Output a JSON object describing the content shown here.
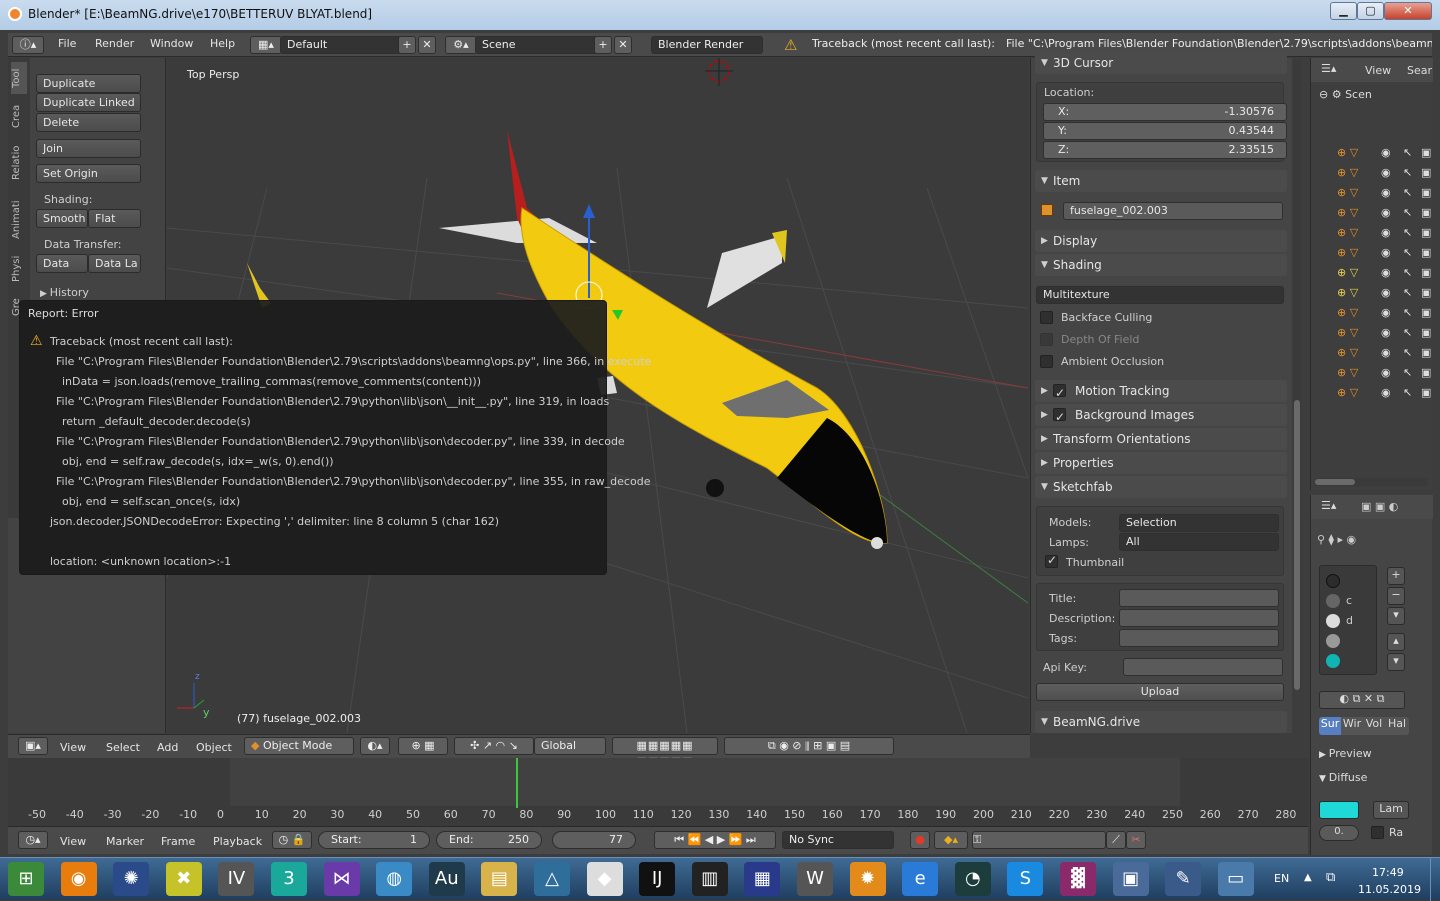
{
  "window": {
    "title": "Blender* [E:\\BeamNG.drive\\e170\\BETTERUV BLYAT.blend]",
    "minimize": "▁",
    "maximize": "▢",
    "close": "✕"
  },
  "infobar": {
    "menus": [
      "File",
      "Render",
      "Window",
      "Help"
    ],
    "screen_layout": "Default",
    "scene": "Scene",
    "render_engine": "Blender Render",
    "report": "Traceback (most recent call last): File \"C:\\Program Files\\Blender Foundation\\Blender\\2.79\\scripts\\addons\\beamng\\ops.py\","
  },
  "toolshelf": {
    "tabs": [
      "Tool",
      "Crea",
      "Relatio",
      "Animati",
      "Physi",
      "Gre"
    ],
    "buttons": [
      "Duplicate",
      "Duplicate Linked",
      "Delete",
      "Join",
      "Set Origin"
    ],
    "shading_label": "Shading:",
    "smooth": "Smooth",
    "flat": "Flat",
    "data_transfer_label": "Data Transfer:",
    "data": "Data",
    "data_la": "Data La",
    "history": "History"
  },
  "viewport": {
    "view_name": "Top Persp",
    "object_label": "(77) fuselage_002.003",
    "axis_z": "z",
    "axis_y": "y"
  },
  "error_report": {
    "header": "Report: Error",
    "lines": [
      "Traceback (most recent call last):",
      "File \"C:\\Program Files\\Blender Foundation\\Blender\\2.79\\scripts\\addons\\beamng\\ops.py\", line 366, in execute",
      "inData = json.loads(remove_trailing_commas(remove_comments(content)))",
      "File \"C:\\Program Files\\Blender Foundation\\Blender\\2.79\\python\\lib\\json\\__init__.py\", line 319, in loads",
      "return _default_decoder.decode(s)",
      "File \"C:\\Program Files\\Blender Foundation\\Blender\\2.79\\python\\lib\\json\\decoder.py\", line 339, in decode",
      "obj, end = self.raw_decode(s, idx=_w(s, 0).end())",
      "File \"C:\\Program Files\\Blender Foundation\\Blender\\2.79\\python\\lib\\json\\decoder.py\", line 355, in raw_decode",
      "obj, end = self.scan_once(s, idx)",
      "json.decoder.JSONDecodeError: Expecting ',' delimiter: line 8 column 5 (char 162)",
      "location: <unknown location>:-1"
    ]
  },
  "properties": {
    "cursor_header": "3D Cursor",
    "location_label": "Location:",
    "x_label": "X:",
    "x": "-1.30576",
    "y_label": "Y:",
    "y": "0.43544",
    "z_label": "Z:",
    "z": "2.33515",
    "item_header": "Item",
    "item_name": "fuselage_002.003",
    "display_header": "Display",
    "shading_header": "Shading",
    "shading_mode": "Multitexture",
    "backface": "Backface Culling",
    "dof": "Depth Of Field",
    "ao": "Ambient Occlusion",
    "motion_tracking": "Motion Tracking",
    "background_images": "Background Images",
    "transform_orientations": "Transform Orientations",
    "properties_header": "Properties",
    "sketchfab_header": "Sketchfab",
    "models_label": "Models:",
    "models_value": "Selection",
    "lamps_label": "Lamps:",
    "lamps_value": "All",
    "thumbnail": "Thumbnail",
    "title_label": "Title:",
    "description_label": "Description:",
    "tags_label": "Tags:",
    "api_key_label": "Api Key:",
    "upload": "Upload",
    "beamng_header": "BeamNG.drive"
  },
  "outliner": {
    "view": "View",
    "search": "Sear",
    "scene_item": "Scen"
  },
  "material": {
    "c": "c",
    "d": "d",
    "sur": "Sur",
    "wir": "Wir",
    "vol": "Vol",
    "hal": "Hal",
    "preview": "Preview",
    "diffuse": "Diffuse",
    "lam": "Lam",
    "val": "0.",
    "ra": "Ra",
    "diffuse_color": "#1fd9d9"
  },
  "view3d_toolbar": {
    "view": "View",
    "select": "Select",
    "add": "Add",
    "object": "Object",
    "mode": "Object Mode",
    "orientation": "Global"
  },
  "timeline": {
    "ticks": [
      "-50",
      "-40",
      "-30",
      "-20",
      "-10",
      "0",
      "10",
      "20",
      "30",
      "40",
      "50",
      "60",
      "70",
      "80",
      "90",
      "100",
      "110",
      "120",
      "130",
      "140",
      "150",
      "160",
      "170",
      "180",
      "190",
      "200",
      "210",
      "220",
      "230",
      "240",
      "250",
      "260",
      "270",
      "280"
    ],
    "current_frame": 77
  },
  "timeline_bar": {
    "view": "View",
    "marker": "Marker",
    "frame": "Frame",
    "playback": "Playback",
    "start_label": "Start:",
    "start": "1",
    "end_label": "End:",
    "end": "250",
    "current": "77",
    "sync": "No Sync"
  },
  "taskbar": {
    "apps": [
      "start",
      "blender",
      "app3",
      "app4",
      "iv",
      "3dsmax",
      "vs",
      "app8",
      "audition",
      "explorer",
      "app11",
      "app12",
      "intellij",
      "app14",
      "app15",
      "w",
      "app17",
      "ie",
      "app19",
      "app20",
      "winrar",
      "app22",
      "app23",
      "app24"
    ],
    "lang": "EN",
    "time": "17:49",
    "date": "11.05.2019"
  }
}
